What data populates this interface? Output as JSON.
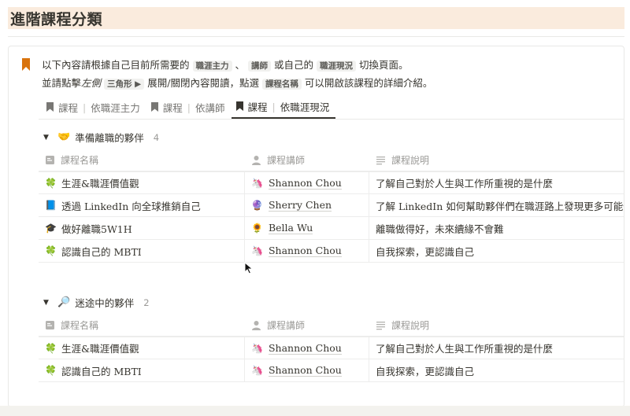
{
  "page": {
    "title": "進階課程分類"
  },
  "intro": {
    "line1_a": "以下內容請根據自己目前所需要的",
    "code1": "職涯主力",
    "line1_b": "、",
    "code2": "講師",
    "line1_c": "或自己的",
    "code3": "職涯現況",
    "line1_d": "切換頁面。",
    "line2_a": "並請點擊",
    "line2_em": "左側",
    "code4": "三角形 ▶",
    "line2_b": "展開/關閉內容閱讀，點選",
    "code5": "課程名稱",
    "line2_c": "可以開啟該課程的詳細介紹。"
  },
  "tabs": [
    {
      "label": "課程",
      "sub": "依職涯主力",
      "active": false
    },
    {
      "label": "課程",
      "sub": "依講師",
      "active": false
    },
    {
      "label": "課程",
      "sub": "依職涯現況",
      "active": true
    }
  ],
  "columns": {
    "name": "課程名稱",
    "teacher": "課程講師",
    "desc": "課程說明"
  },
  "groups": [
    {
      "emoji": "🤝",
      "title": "準備離職的夥伴",
      "count": "4",
      "rows": [
        {
          "icon": "🍀",
          "name": "生涯&職涯價值觀",
          "avatar": "🦄",
          "teacher": "Shannon Chou",
          "desc": "了解自己對於人生與工作所重視的是什麼"
        },
        {
          "icon": "📘",
          "name": "透過 LinkedIn 向全球推銷自己",
          "avatar": "🔮",
          "teacher": "Sherry Chen",
          "desc": "了解 LinkedIn 如何幫助夥伴們在職涯路上發現更多可能性"
        },
        {
          "icon": "🎓",
          "name": "做好離職5W1H",
          "avatar": "🌻",
          "teacher": "Bella Wu",
          "desc": "離職做得好，未來續緣不會難"
        },
        {
          "icon": "🍀",
          "name": "認識自己的 MBTI",
          "avatar": "🦄",
          "teacher": "Shannon Chou",
          "desc": "自我探索，更認識自己"
        }
      ]
    },
    {
      "emoji": "🔎",
      "title": "迷途中的夥伴",
      "count": "2",
      "rows": [
        {
          "icon": "🍀",
          "name": "生涯&職涯價值觀",
          "avatar": "🦄",
          "teacher": "Shannon Chou",
          "desc": "了解自己對於人生與工作所重視的是什麼"
        },
        {
          "icon": "🍀",
          "name": "認識自己的 MBTI",
          "avatar": "🦄",
          "teacher": "Shannon Chou",
          "desc": "自我探索，更認識自己"
        }
      ]
    }
  ]
}
